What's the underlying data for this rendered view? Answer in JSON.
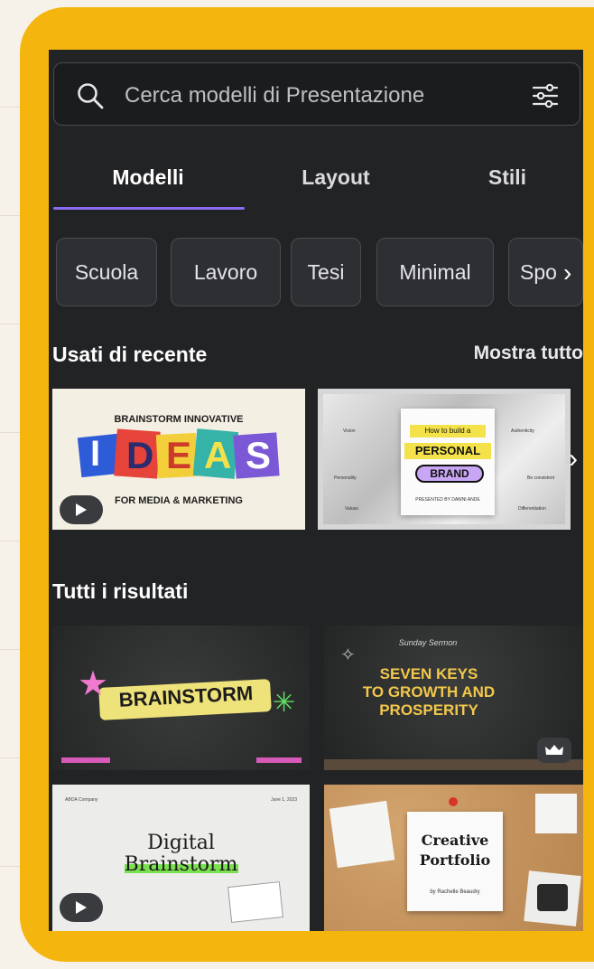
{
  "search": {
    "placeholder": "Cerca modelli di Presentazione"
  },
  "tabs": [
    {
      "label": "Modelli",
      "active": true
    },
    {
      "label": "Layout",
      "active": false
    },
    {
      "label": "Stili",
      "active": false
    }
  ],
  "chips": [
    "Scuola",
    "Lavoro",
    "Tesi",
    "Minimal",
    "Spo"
  ],
  "recent": {
    "title": "Usati di recente",
    "show_all": "Mostra tutto",
    "items": [
      {
        "header": "BRAINSTORM INNOVATIVE",
        "letters": [
          "I",
          "D",
          "E",
          "A",
          "S"
        ],
        "footer": "FOR MEDIA & MARKETING",
        "video": true
      },
      {
        "small": "How to build a",
        "line1": "PERSONAL",
        "line2": "BRAND",
        "credit": "PRESENTED BY DAWNI ANDE",
        "labels": [
          "Vision",
          "Personality",
          "Values",
          "Authenticity",
          "Be consistent",
          "Differentiation"
        ]
      }
    ]
  },
  "results": {
    "title": "Tutti i risultati",
    "items": [
      {
        "word": "BRAINSTORM"
      },
      {
        "top": "Sunday Sermon",
        "line1": "SEVEN KEYS",
        "line2": "TO GROWTH AND",
        "line3": "PROSPERITY",
        "premium": true
      },
      {
        "company": "ABOA Company",
        "date": "June 1, 2023",
        "line1": "Digital",
        "line2": "Brainstorm",
        "video": true
      },
      {
        "line1": "Creative",
        "line2": "Portfolio",
        "author": "by Rachelle Beaudry"
      }
    ]
  },
  "colors": {
    "frame": "#f4b50f",
    "panel": "#222325",
    "accent": "#8b6cf2"
  }
}
